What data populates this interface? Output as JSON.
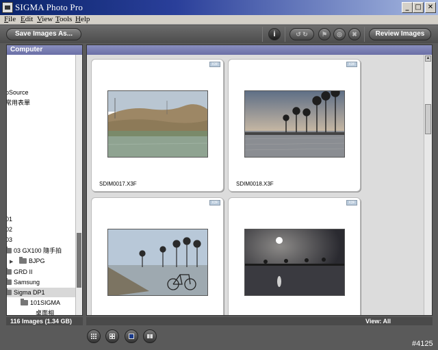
{
  "window": {
    "title": "SIGMA Photo Pro"
  },
  "menu": [
    "File",
    "Edit",
    "View",
    "Tools",
    "Help"
  ],
  "toolbar": {
    "save_label": "Save Images As...",
    "review_label": "Review Images",
    "info_label": "i"
  },
  "left_panel": {
    "header": "Computer",
    "tree": [
      {
        "label": "pSource",
        "indent": 0,
        "folder": false
      },
      {
        "label": "常用表單",
        "indent": 0,
        "folder": false
      },
      {
        "label": "01",
        "indent": 0,
        "folder": false
      },
      {
        "label": "02",
        "indent": 0,
        "folder": false
      },
      {
        "label": "03",
        "indent": 0,
        "folder": false
      },
      {
        "label": "03 GX100 隨手拍",
        "indent": 0,
        "folder": true
      },
      {
        "label": "BJPG",
        "indent": 1,
        "folder": true,
        "expander": "▶"
      },
      {
        "label": "GRD II",
        "indent": 0,
        "folder": true
      },
      {
        "label": "Samsung",
        "indent": 0,
        "folder": true
      },
      {
        "label": "Sigma DP1",
        "indent": 0,
        "folder": true,
        "selected": true
      },
      {
        "label": "101SIGMA",
        "indent": 2,
        "folder": true
      },
      {
        "label": "桌面相",
        "indent": 2,
        "folder": false
      }
    ],
    "status": "116 Images   (1.34 GB)"
  },
  "main_panel": {
    "view_label": "View: All",
    "thumbnails": [
      {
        "name": "SDIM0017.X3F",
        "badge": "X3F",
        "scene": "hillside-field"
      },
      {
        "name": "SDIM0018.X3F",
        "badge": "X3F",
        "scene": "palms-sunset"
      },
      {
        "name": "",
        "badge": "X3F",
        "scene": "bicycle-palms"
      },
      {
        "name": "",
        "badge": "X3F",
        "scene": "sun-silhouette"
      }
    ]
  },
  "bottom": {
    "watermark": "#4125"
  },
  "colors": {
    "panel_header": "#7a7fb6",
    "title_bar": "#0a246a"
  }
}
